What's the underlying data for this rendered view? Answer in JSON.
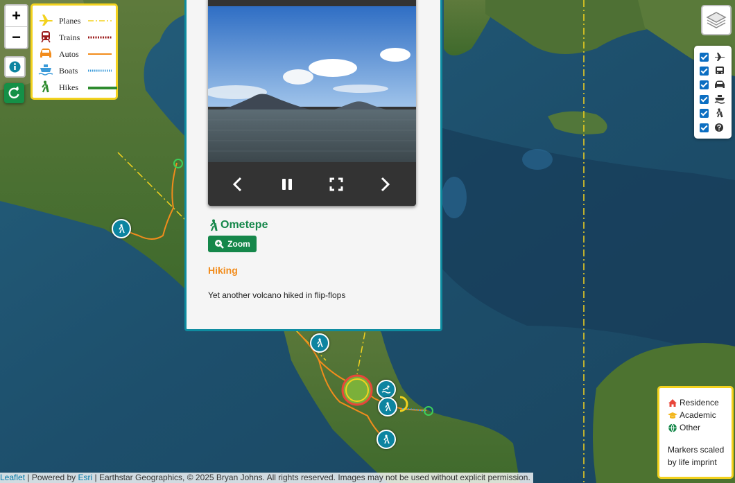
{
  "map_controls": {
    "zoom_in": "+",
    "zoom_out": "−"
  },
  "transport_legend": [
    {
      "label": "Planes",
      "icon": "plane-icon",
      "color": "#f3d21e",
      "style": "dash-dot"
    },
    {
      "label": "Trains",
      "icon": "train-icon",
      "color": "#9b1b1b",
      "style": "dotted"
    },
    {
      "label": "Autos",
      "icon": "car-icon",
      "color": "#f28c1c",
      "style": "solid"
    },
    {
      "label": "Boats",
      "icon": "ship-icon",
      "color": "#3a9ad9",
      "style": "dotted"
    },
    {
      "label": "Hikes",
      "icon": "hiker-icon",
      "color": "#2e8b2e",
      "style": "solid-thick"
    }
  ],
  "popup": {
    "title": "Ometepe",
    "zoom_label": "Zoom",
    "category": "Hiking",
    "description": "Yet another volcano hiked in flip-flops",
    "photo_controls": [
      "chevron-left-icon",
      "pause-icon",
      "fullscreen-icon",
      "chevron-right-icon"
    ]
  },
  "layer_filters": [
    {
      "icon": "plane-icon",
      "checked": true
    },
    {
      "icon": "bus-icon",
      "checked": true
    },
    {
      "icon": "car-icon",
      "checked": true
    },
    {
      "icon": "ship-icon",
      "checked": true
    },
    {
      "icon": "hiker-icon",
      "checked": true
    },
    {
      "icon": "question-icon",
      "checked": true
    }
  ],
  "marker_legend": {
    "items": [
      {
        "label": "Residence",
        "icon": "home-icon",
        "color": "#e8463a"
      },
      {
        "label": "Academic",
        "icon": "graduation-cap-icon",
        "color": "#f3b71e"
      },
      {
        "label": "Other",
        "icon": "globe-icon",
        "color": "#15874a"
      }
    ],
    "note": "Markers scaled by life imprint"
  },
  "attribution": {
    "leaflet": "Leaflet",
    "sep1": " | Powered by ",
    "esri": "Esri",
    "rest": " | Earthstar Geographics, © 2025 Bryan Johns. All rights reserved. Images may not be used without explicit permission."
  },
  "colors": {
    "accent_green": "#15874a",
    "popup_border": "#0e8ca0",
    "legend_border": "#f3d21e",
    "marker_teal": "#0c84a0"
  }
}
